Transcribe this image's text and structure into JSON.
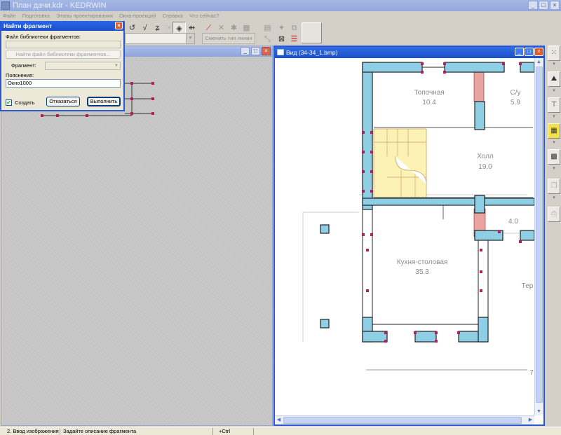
{
  "main_window": {
    "title": "План дачи.kdr - KEDRWIN"
  },
  "menu": [
    "Файл",
    "Подготовка",
    "Этапы проектирования",
    "Окна-проекций",
    "Справка",
    "Что сейчас?"
  ],
  "toolbar": {
    "line_type_button": "Сменить тип линии"
  },
  "left_window": {
    "title": ""
  },
  "right_window": {
    "title": "Вид (34-34_1.bmp)"
  },
  "floor_plan": {
    "rooms": [
      {
        "name": "Топочная",
        "area": "10.4"
      },
      {
        "name": "С/у",
        "area": "5.9"
      },
      {
        "name": "Холл",
        "area": "19.0"
      },
      {
        "name": "Кухня-столовая",
        "area": "35.3"
      },
      {
        "name": "",
        "area": "4.0"
      },
      {
        "name": "Тер",
        "area": ""
      },
      {
        "name": "",
        "area": "7"
      }
    ]
  },
  "dialog": {
    "title": "Найти фрагмент",
    "library_label": "Файл библиотеки фрагментов:",
    "library_value": "",
    "find_library_button": "Найти файл библиотеки фрагментов...",
    "fragment_label": "Фрагмент:",
    "fragment_value": "",
    "notes_label": "Пояснения:",
    "notes_value": "Окно1000",
    "create_checkbox_label": "Создать",
    "create_checked": true,
    "cancel_button": "Отказаться",
    "execute_button": "Выполнить"
  },
  "statusbar": {
    "mode": "2. Ввод изображения",
    "hint": "Задайте описание фрагмента",
    "modifier": "+Ctrl"
  },
  "colors": {
    "wall_fill": "#8ecfe6",
    "stair_fill": "#fbf2b3",
    "node": "#b02060",
    "chimney": "#e8a5a0",
    "active_title": "#2258d6",
    "inactive_title": "#9fb3e6"
  }
}
